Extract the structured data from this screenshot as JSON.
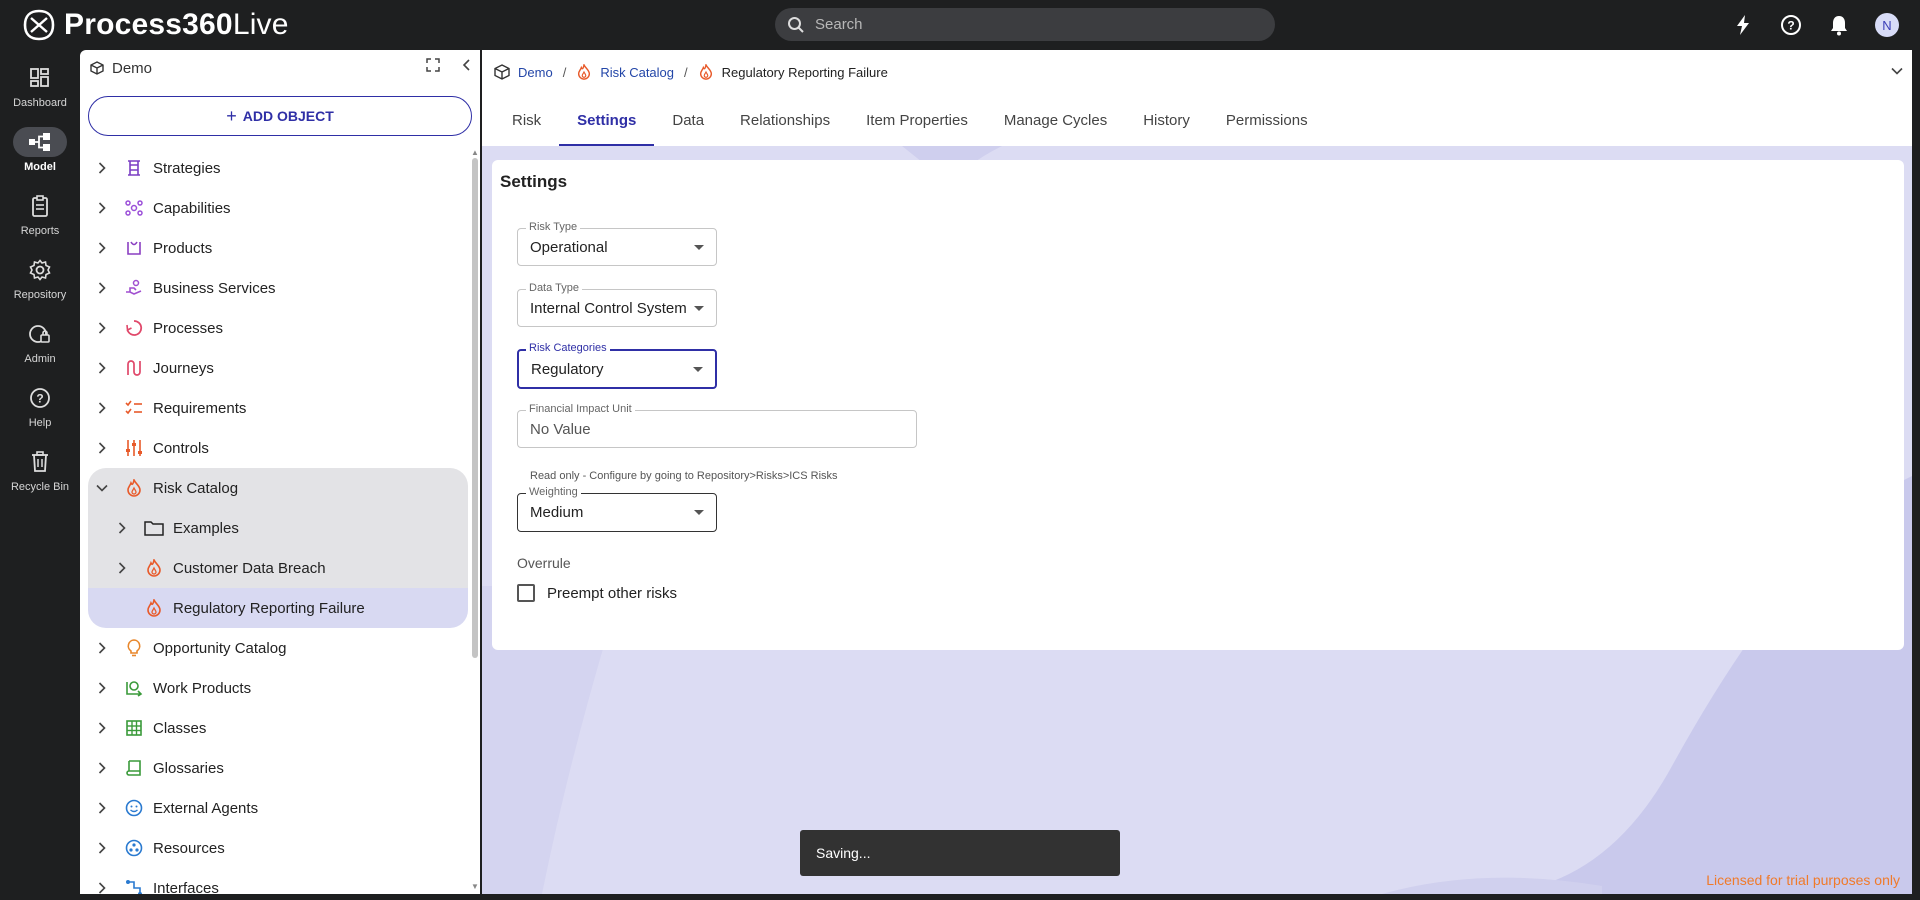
{
  "app": {
    "brand_bold": "Process360",
    "brand_light": "Live"
  },
  "search": {
    "placeholder": "Search"
  },
  "user": {
    "initial": "N"
  },
  "rail": [
    {
      "label": "Dashboard",
      "icon": "dashboard-icon"
    },
    {
      "label": "Model",
      "icon": "model-icon",
      "active": true
    },
    {
      "label": "Reports",
      "icon": "reports-icon"
    },
    {
      "label": "Repository",
      "icon": "repository-icon"
    },
    {
      "label": "Admin",
      "icon": "admin-icon"
    },
    {
      "label": "Help",
      "icon": "help-icon"
    },
    {
      "label": "Recycle Bin",
      "icon": "recycle-bin-icon"
    }
  ],
  "tree": {
    "title": "Demo",
    "add_label": "ADD OBJECT",
    "items": [
      {
        "label": "Strategies",
        "color": "#7b3fc4"
      },
      {
        "label": "Capabilities",
        "color": "#9b4fd8"
      },
      {
        "label": "Products",
        "color": "#8a3fc2"
      },
      {
        "label": "Business Services",
        "color": "#a04fd0"
      },
      {
        "label": "Processes",
        "color": "#e0486a"
      },
      {
        "label": "Journeys",
        "color": "#e0486a"
      },
      {
        "label": "Requirements",
        "color": "#e85a2a"
      },
      {
        "label": "Controls",
        "color": "#e85a2a"
      },
      {
        "label": "Risk Catalog",
        "color": "#e85a2a"
      },
      {
        "label": "Examples",
        "color": "#222222"
      },
      {
        "label": "Customer Data Breach",
        "color": "#e85a2a"
      },
      {
        "label": "Regulatory Reporting Failure",
        "color": "#e85a2a"
      },
      {
        "label": "Opportunity Catalog",
        "color": "#e8862a"
      },
      {
        "label": "Work Products",
        "color": "#3a9a3a"
      },
      {
        "label": "Classes",
        "color": "#3a9a3a"
      },
      {
        "label": "Glossaries",
        "color": "#3a9a3a"
      },
      {
        "label": "External Agents",
        "color": "#2a7ad0"
      },
      {
        "label": "Resources",
        "color": "#2a7ad0"
      },
      {
        "label": "Interfaces",
        "color": "#2a7ad0"
      }
    ]
  },
  "breadcrumb": {
    "root": "Demo",
    "parent": "Risk Catalog",
    "current": "Regulatory Reporting Failure"
  },
  "tabs": [
    "Risk",
    "Settings",
    "Data",
    "Relationships",
    "Item Properties",
    "Manage Cycles",
    "History",
    "Permissions"
  ],
  "settings": {
    "title": "Settings",
    "risk_type": {
      "label": "Risk Type",
      "value": "Operational"
    },
    "data_type": {
      "label": "Data Type",
      "value": "Internal Control System"
    },
    "risk_categories": {
      "label": "Risk Categories",
      "value": "Regulatory"
    },
    "financial_impact_unit": {
      "label": "Financial Impact Unit",
      "value": "No Value",
      "helper": "Read only - Configure by going to Repository>Risks>ICS Risks"
    },
    "weighting": {
      "label": "Weighting",
      "value": "Medium"
    },
    "overrule": {
      "section": "Overrule",
      "checkbox_label": "Preempt other risks",
      "checked": false
    }
  },
  "toast": "Saving...",
  "license": "Licensed for trial purposes only",
  "colors": {
    "accent": "#2f2fa6",
    "risk": "#e85a2a",
    "license": "#f07a2a"
  }
}
